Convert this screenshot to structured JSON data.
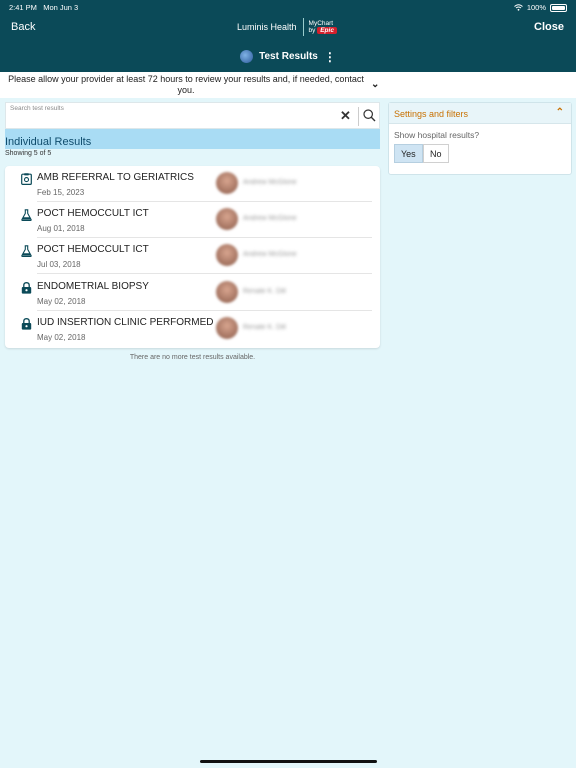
{
  "status": {
    "time": "2:41 PM",
    "date": "Mon Jun 3",
    "battery": "100%"
  },
  "nav": {
    "back": "Back",
    "close": "Close",
    "brand_left": "Luminis Health",
    "brand_right_top": "MyChart",
    "brand_right_by": "by",
    "brand_right_epic": "Epic",
    "title": "Test Results",
    "menu_glyph": "⋮"
  },
  "notice": {
    "text": "Please allow your provider at least 72 hours to review your results and, if needed, contact you.",
    "chevron": "⌄"
  },
  "search": {
    "placeholder": "Search test results",
    "clear_glyph": "✕"
  },
  "section": {
    "title": "Individual Results",
    "showing": "Showing 5 of 5"
  },
  "results": [
    {
      "name": "AMB REFERRAL TO GERIATRICS",
      "date": "Feb 15, 2023",
      "provider": "Andrew McGlone",
      "icon": "clipboard-icon"
    },
    {
      "name": "POCT HEMOCCULT ICT",
      "date": "Aug 01, 2018",
      "provider": "Andrew McGlone",
      "icon": "flask-icon"
    },
    {
      "name": "POCT HEMOCCULT ICT",
      "date": "Jul 03, 2018",
      "provider": "Andrew McGlone",
      "icon": "flask-icon"
    },
    {
      "name": "ENDOMETRIAL BIOPSY",
      "date": "May 02, 2018",
      "provider": "Renate K. Dill",
      "icon": "lock-icon"
    },
    {
      "name": "IUD INSERTION CLINIC PERFORMED",
      "date": "May 02, 2018",
      "provider": "Renate K. Dill",
      "icon": "lock-icon"
    }
  ],
  "no_more": "There are no more test results available.",
  "filters": {
    "title": "Settings and filters",
    "chevron": "⌃",
    "question": "Show hospital results?",
    "yes": "Yes",
    "no": "No",
    "selected": "Yes"
  },
  "colors": {
    "header": "#0b4a58",
    "background": "#e3f6fa",
    "section": "#a9dcf4",
    "accent": "#c87000",
    "brand_epic": "#d4202c"
  }
}
